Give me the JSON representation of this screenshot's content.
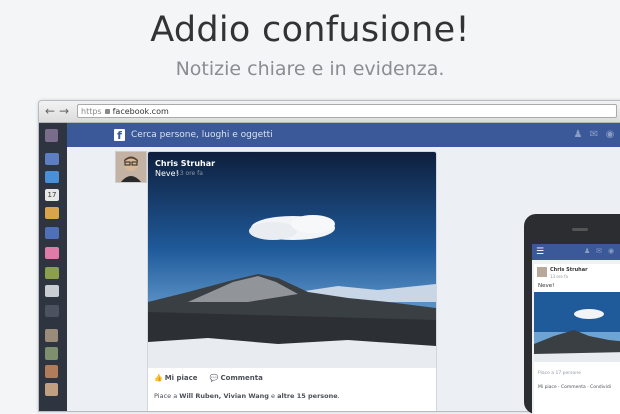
{
  "headline": "Addio confusione!",
  "subheadline": "Notizie chiare e in evidenza.",
  "browser": {
    "url_scheme": "https",
    "url_host": "facebook.com"
  },
  "facebook": {
    "logo": "f",
    "search_placeholder": "Cerca persone, luoghi e oggetti",
    "calendar_day": "17"
  },
  "post": {
    "author": "Chris Struhar",
    "text": "Neve!",
    "time": "13 ore fa",
    "like_label": "Mi piace",
    "comment_label": "Commenta",
    "likes_prefix": "Piace a",
    "likes_names": "Will Ruben, Vivian Wang",
    "likes_middle": "e",
    "likes_others": "altre 15 persone",
    "likes_suffix": "."
  },
  "phone": {
    "author": "Chris Struhar",
    "time": "13 ore fa",
    "text": "Neve!",
    "likes": "Piace a 17 persone",
    "actions": "Mi piace · Commenta · Condividi"
  },
  "icons": [
    "back-arrow-icon",
    "forward-arrow-icon",
    "lock-icon",
    "facebook-logo-icon",
    "friends-icon",
    "messages-icon",
    "globe-icon",
    "menu-icon"
  ],
  "colors": {
    "facebook_blue": "#3b5998",
    "rail": "#2e3440",
    "page": "#f4f5f7"
  }
}
